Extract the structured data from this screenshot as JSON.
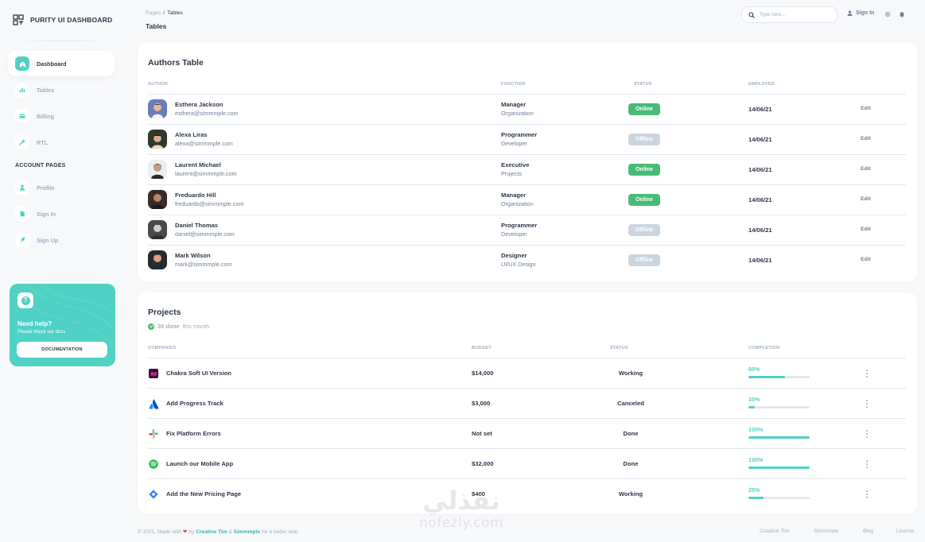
{
  "brand": {
    "title": "PURITY UI DASHBOARD"
  },
  "sidebar": {
    "items": [
      {
        "label": "Dashboard",
        "icon": "home-icon",
        "active": true
      },
      {
        "label": "Tables",
        "icon": "bar-chart-icon",
        "active": false
      },
      {
        "label": "Billing",
        "icon": "credit-card-icon",
        "active": false
      },
      {
        "label": "RTL",
        "icon": "wrench-icon",
        "active": false
      }
    ],
    "section_title": "ACCOUNT PAGES",
    "account_items": [
      {
        "label": "Profile",
        "icon": "person-icon"
      },
      {
        "label": "Sign In",
        "icon": "document-icon"
      },
      {
        "label": "Sign Up",
        "icon": "rocket-icon"
      }
    ],
    "help": {
      "icon": "question-icon",
      "title": "Need help?",
      "subtitle": "Please check our docs",
      "button": "DOCUMENTATION"
    }
  },
  "header": {
    "breadcrumb_root": "Pages",
    "breadcrumb_sep": "/",
    "breadcrumb_current": "Tables",
    "page_title": "Tables",
    "search_placeholder": "Type here...",
    "sign_in": "Sign In"
  },
  "authors_table": {
    "title": "Authors Table",
    "columns": [
      "AUTHOR",
      "FUNCTION",
      "STATUS",
      "EMPLOYED"
    ],
    "rows": [
      {
        "name": "Esthera Jackson",
        "email": "esthera@simmmple.com",
        "role": "Manager",
        "dept": "Organization",
        "status": "Online",
        "employed": "14/06/21",
        "action": "Edit"
      },
      {
        "name": "Alexa Liras",
        "email": "alexa@simmmple.com",
        "role": "Programmer",
        "dept": "Developer",
        "status": "Offline",
        "employed": "14/06/21",
        "action": "Edit"
      },
      {
        "name": "Laurent Michael",
        "email": "laurent@simmmple.com",
        "role": "Executive",
        "dept": "Projects",
        "status": "Online",
        "employed": "14/06/21",
        "action": "Edit"
      },
      {
        "name": "Freduardo Hill",
        "email": "freduardo@simmmple.com",
        "role": "Manager",
        "dept": "Organization",
        "status": "Online",
        "employed": "14/06/21",
        "action": "Edit"
      },
      {
        "name": "Daniel Thomas",
        "email": "daniel@simmmple.com",
        "role": "Programmer",
        "dept": "Developer",
        "status": "Offline",
        "employed": "14/06/21",
        "action": "Edit"
      },
      {
        "name": "Mark Wilson",
        "email": "mark@simmmple.com",
        "role": "Designer",
        "dept": "UI/UX Design",
        "status": "Offline",
        "employed": "14/06/21",
        "action": "Edit"
      }
    ]
  },
  "projects": {
    "title": "Projects",
    "done_count": "30 done",
    "done_suffix": "this month",
    "columns": [
      "COMPANIES",
      "BUDGET",
      "STATUS",
      "COMPLETION"
    ],
    "rows": [
      {
        "name": "Chakra Soft UI Version",
        "logo": "xd-logo-icon",
        "logo_text": "Xd",
        "budget": "$14,000",
        "status": "Working",
        "completion": "60%",
        "progress": 60
      },
      {
        "name": "Add Progress Track",
        "logo": "atlassian-logo-icon",
        "budget": "$3,000",
        "status": "Canceled",
        "completion": "10%",
        "progress": 10
      },
      {
        "name": "Fix Platform Errors",
        "logo": "slack-logo-icon",
        "budget": "Not set",
        "status": "Done",
        "completion": "100%",
        "progress": 100
      },
      {
        "name": "Launch our Mobile App",
        "logo": "spotify-logo-icon",
        "budget": "$32,000",
        "status": "Done",
        "completion": "100%",
        "progress": 100
      },
      {
        "name": "Add the New Pricing Page",
        "logo": "jira-logo-icon",
        "budget": "$400",
        "status": "Working",
        "completion": "25%",
        "progress": 25
      }
    ]
  },
  "footer": {
    "copy": "© 2021, Made with",
    "by": "by",
    "author1": "Creative Tim",
    "amp": "&",
    "author2": "Simmmple",
    "suffix": "for a better web",
    "links": [
      "Creative Tim",
      "Simmmple",
      "Blog",
      "License"
    ]
  },
  "watermark": {
    "arabic": "نفذلي",
    "latin": "nofezly.com"
  },
  "colors": {
    "accent": "#4fd1c5",
    "online": "#48bb78",
    "offline": "#cbd5e0",
    "text": "#2d3748",
    "muted": "#a0aec0"
  }
}
